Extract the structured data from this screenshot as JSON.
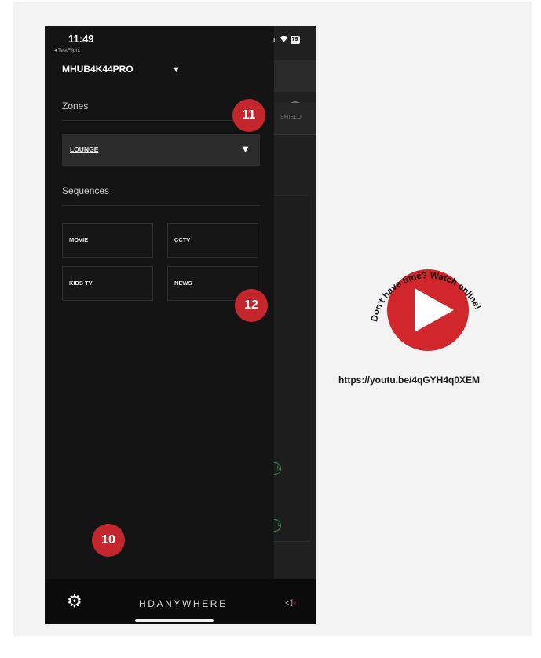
{
  "status_bar": {
    "time": "11:49",
    "back_label": "◂ TestFlight",
    "battery": "79"
  },
  "drawer": {
    "device_name": "MHUB4K44PRO",
    "zones_label": "Zones",
    "selected_zone": "LOUNGE",
    "sequences_label": "Sequences",
    "sequences": [
      "MOVIE",
      "CCTV",
      "KIDS TV",
      "NEWS"
    ]
  },
  "background_app": {
    "tab_label": "SHIELD"
  },
  "footer": {
    "brand": "HDANYWHERE"
  },
  "badges": {
    "zone": "11",
    "sequences": "12",
    "settings": "10"
  },
  "promo": {
    "curved_text": "Don't have time? Watch online!",
    "url": "https://youtu.be/4qGYH4q0XEM"
  },
  "colors": {
    "accent_red": "#c4262e",
    "phone_bg": "#151515",
    "card_bg": "#f3f3f3"
  },
  "icons": [
    "gear-icon",
    "speaker-muted-icon",
    "power-icon",
    "dropdown-caret-icon",
    "play-icon",
    "wifi-icon",
    "signal-icon"
  ]
}
